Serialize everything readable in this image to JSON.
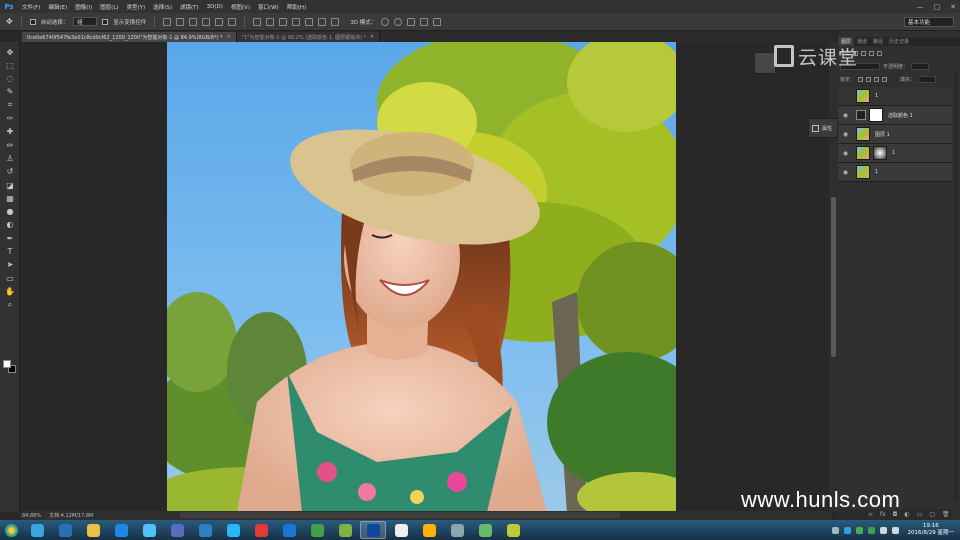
{
  "app": {
    "logo": "Ps",
    "menus": [
      "文件(F)",
      "编辑(E)",
      "图像(I)",
      "图层(L)",
      "类型(Y)",
      "选择(S)",
      "滤镜(T)",
      "3D(D)",
      "视图(V)",
      "窗口(W)",
      "帮助(H)"
    ],
    "window_controls": [
      "—",
      "□",
      "✕"
    ]
  },
  "options_bar": {
    "auto_select_label": "自动选择：",
    "auto_select_value": "组",
    "show_transform_label": "显示变换控件",
    "mode_3d_label": "3D 模式：",
    "workspace": "基本功能"
  },
  "tabs": [
    {
      "label": "0ce0e6740f547fe3e01c8cd0cf62_1200_1200\"为智能对象-1 @ 84.9%(RGB/8*) *",
      "active": true
    },
    {
      "label": "\"1\"为智能对象-1 @ 90.2% (选取颜色 1, 图层蒙版/8) *",
      "active": false
    }
  ],
  "toolbar": {
    "tools": [
      "move-tool-icon",
      "marquee-tool-icon",
      "lasso-tool-icon",
      "quick-select-tool-icon",
      "crop-tool-icon",
      "eyedropper-tool-icon",
      "healing-tool-icon",
      "brush-tool-icon",
      "clone-stamp-tool-icon",
      "history-brush-tool-icon",
      "eraser-tool-icon",
      "gradient-tool-icon",
      "blur-tool-icon",
      "dodge-tool-icon",
      "pen-tool-icon",
      "type-tool-icon",
      "path-select-tool-icon",
      "shape-tool-icon",
      "hand-tool-icon",
      "zoom-tool-icon"
    ],
    "tool_glyphs": [
      "✥",
      "⬚",
      "◌",
      "✎",
      "⌗",
      "✑",
      "✚",
      "✏",
      "♙",
      "↺",
      "◪",
      "▦",
      "●",
      "◐",
      "✒",
      "T",
      "➤",
      "▭",
      "✋",
      "⌕"
    ]
  },
  "status": {
    "zoom": "84.88%",
    "doc_size": "文档:4.12M/17.8M"
  },
  "panels": {
    "tabs": [
      {
        "label": "图层",
        "active": true
      },
      {
        "label": "通道",
        "active": false
      },
      {
        "label": "路径",
        "active": false
      },
      {
        "label": "历史记录",
        "active": false
      }
    ],
    "kind_label": "类型",
    "opacity_label": "不透明度：",
    "lock_label": "锁定：",
    "fill_label": "填充：",
    "layers": [
      {
        "name": "1",
        "visible": false,
        "type": "photo"
      },
      {
        "name": "选取颜色 1",
        "visible": true,
        "type": "adjustment"
      },
      {
        "name": "图层 1",
        "visible": true,
        "type": "photo"
      },
      {
        "name": "1",
        "visible": true,
        "type": "photo-mask"
      },
      {
        "name": "1",
        "visible": true,
        "type": "photo"
      }
    ],
    "properties_label": "属性"
  },
  "watermark": {
    "logo_text": "云课堂",
    "url": "www.hunls.com"
  },
  "taskbar": {
    "apps": [
      "360-safe-icon",
      "ie-icon",
      "explorer-icon",
      "kugou-icon",
      "network-icon",
      "app-window-icon",
      "folder-icon",
      "cloud-icon",
      "media-icon",
      "player-icon",
      "browser-icon",
      "iqiyi-icon",
      "photoshop-icon",
      "qq-icon",
      "game-icon",
      "notes-icon",
      "wechat-icon",
      "files-icon"
    ],
    "time": "19:16",
    "date": "2016/8/29 星期一"
  },
  "colors": {
    "ps_blue": "#31a8ff",
    "panel_bg": "#303030",
    "taskbar": "#1b3950"
  }
}
